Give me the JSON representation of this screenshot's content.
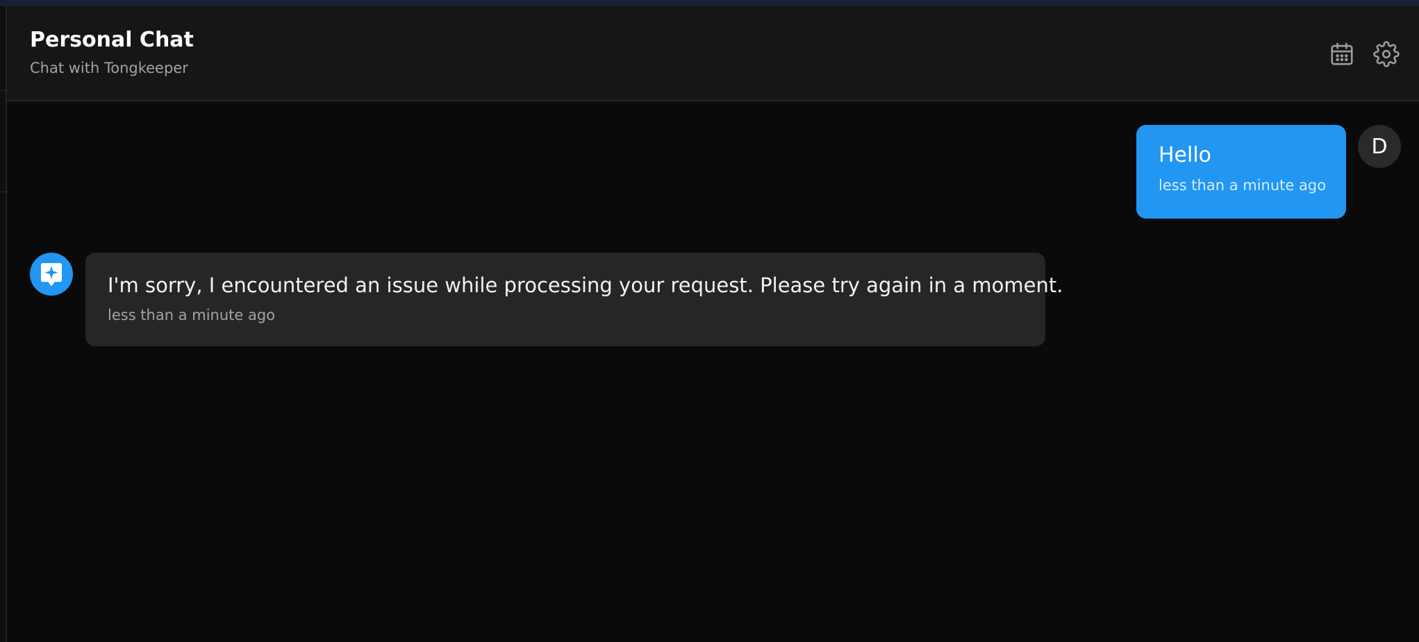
{
  "header": {
    "title": "Personal Chat",
    "subtitle": "Chat with Tongkeeper",
    "icons": [
      "calendar-icon",
      "gear-icon"
    ]
  },
  "messages": [
    {
      "sender": "user",
      "avatar_initial": "D",
      "text": "Hello",
      "time": "less than a minute ago"
    },
    {
      "sender": "assistant",
      "avatar_icon": "sparkle-chat-icon",
      "text": "I'm sorry, I encountered an issue while processing your request. Please try again in a moment.",
      "time": "less than a minute ago"
    }
  ],
  "colors": {
    "accent": "#2196f3",
    "background": "#0a0a0a",
    "header_bg": "#161616",
    "bot_bubble": "#262626"
  }
}
